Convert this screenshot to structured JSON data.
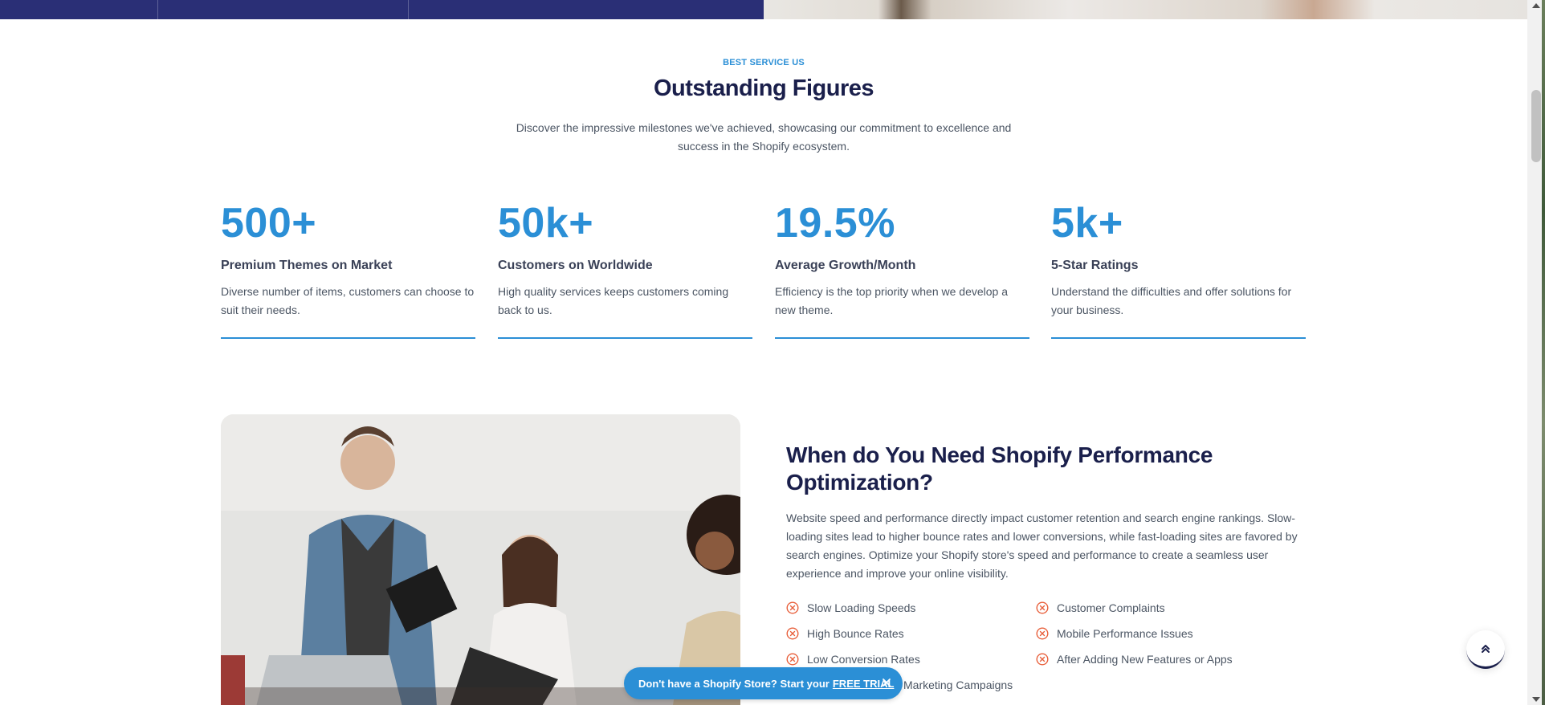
{
  "section": {
    "eyebrow": "BEST SERVICE US",
    "title": "Outstanding Figures",
    "description": "Discover the impressive milestones we've achieved, showcasing our commitment to excellence and success in the Shopify ecosystem."
  },
  "stats": [
    {
      "value": "500+",
      "label": "Premium Themes on Market",
      "desc": "Diverse number of items, customers can choose to suit their needs."
    },
    {
      "value": "50k+",
      "label": "Customers on Worldwide",
      "desc": "High quality services keeps customers coming back to us."
    },
    {
      "value": "19.5%",
      "label": "Average Growth/Month",
      "desc": "Efficiency is the top priority when we develop a new theme."
    },
    {
      "value": "5k+",
      "label": "5-Star Ratings",
      "desc": "Understand the difficulties and offer solutions for your business."
    }
  ],
  "content": {
    "title": "When do You Need Shopify Performance Optimization?",
    "body": "Website speed and performance directly impact customer retention and search engine rankings. Slow-loading sites lead to higher bounce rates and lower conversions, while fast-loading sites are favored by search engines. Optimize your Shopify store's speed and performance to create a seamless user experience and improve your online visibility.",
    "issues_left": [
      "Slow Loading Speeds",
      "High Bounce Rates",
      "Low Conversion Rates",
      "Marketing Campaigns"
    ],
    "issues_right": [
      "Customer Complaints",
      "Mobile Performance Issues",
      "After Adding New Features or Apps"
    ]
  },
  "trial_banner": {
    "text": "Don't have a Shopify Store? Start your",
    "link": "FREE TRIAL"
  },
  "colors": {
    "accent": "#2b8fd6",
    "navy": "#1a1f4b",
    "issue_icon": "#e8603c"
  },
  "icons": {
    "issue": "x-circle-icon",
    "close": "close-icon",
    "back_to_top": "double-chevron-up-icon"
  }
}
